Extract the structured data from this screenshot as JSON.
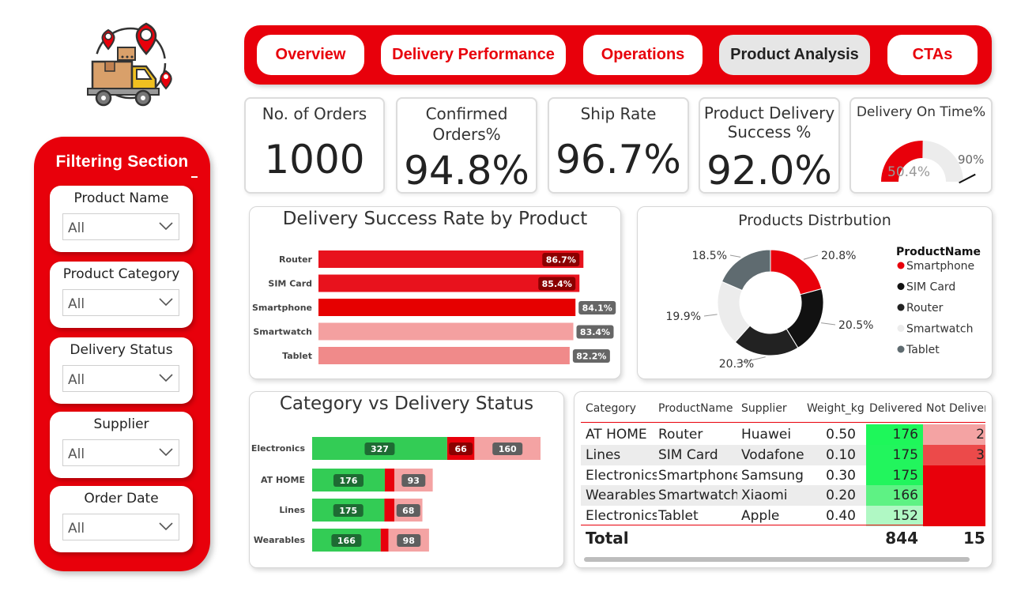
{
  "nav": {
    "tabs": [
      {
        "label": "Overview",
        "active": false
      },
      {
        "label": "Delivery Performance",
        "active": false
      },
      {
        "label": "Operations",
        "active": false
      },
      {
        "label": "Product Analysis",
        "active": true
      },
      {
        "label": "CTAs",
        "active": false
      }
    ]
  },
  "filters": {
    "title": "Filtering Section",
    "items": [
      {
        "label": "Product Name",
        "value": "All"
      },
      {
        "label": "Product Category",
        "value": "All"
      },
      {
        "label": "Delivery Status",
        "value": "All"
      },
      {
        "label": "Supplier",
        "value": "All"
      },
      {
        "label": "Order Date",
        "value": "All"
      }
    ]
  },
  "kpis": {
    "orders": {
      "title": "No. of Orders",
      "value": "1000"
    },
    "confirmed": {
      "title1": "Confirmed",
      "title2": "Orders%",
      "value": "94.8%"
    },
    "ship_rate": {
      "title": "Ship Rate",
      "value": "96.7%"
    },
    "success": {
      "title1": "Product Delivery",
      "title2": "Success %",
      "value": "92.0%"
    },
    "on_time": {
      "title": "Delivery On Time%",
      "value": "50.4%",
      "target": "90%"
    }
  },
  "colors": {
    "brand_red": "#e8000b",
    "dark_red": "#8b0000",
    "light_red": "#f4a3a3",
    "green": "#33cc55",
    "dark_green": "#1e6b33",
    "grey": "#5f6b70"
  },
  "chart_data": [
    {
      "type": "gauge",
      "title": "Delivery On Time%",
      "value": 50.4,
      "target": 90,
      "ylim": [
        0,
        100
      ]
    },
    {
      "type": "bar",
      "orientation": "horizontal",
      "title": "Delivery Success Rate by Product",
      "categories": [
        "Router",
        "SIM Card",
        "Smartphone",
        "Smartwatch",
        "Tablet"
      ],
      "values": [
        86.7,
        85.4,
        84.1,
        83.4,
        82.2
      ],
      "labels": [
        "86.7%",
        "85.4%",
        "84.1%",
        "83.4%",
        "82.2%"
      ],
      "colors": [
        "#e8121d",
        "#e8121d",
        "#e60000",
        "#f4a0a0",
        "#f08a8a"
      ],
      "label_bg": [
        "#8b0000",
        "#8b0000",
        "#666666",
        "#666666",
        "#666666"
      ],
      "xlim": [
        0,
        100
      ]
    },
    {
      "type": "pie",
      "donut": true,
      "title": "Products Distrbution",
      "legend_title": "ProductName",
      "legend_position": "right",
      "slices": [
        {
          "name": "Smartphone",
          "value": 20.8,
          "label": "20.8%",
          "color": "#e8000b"
        },
        {
          "name": "SIM Card",
          "value": 20.5,
          "label": "20.5%",
          "color": "#111111"
        },
        {
          "name": "Router",
          "value": 20.3,
          "label": "20.3%",
          "color": "#222222"
        },
        {
          "name": "Smartwatch",
          "value": 19.9,
          "label": "19.9%",
          "color": "#ececec"
        },
        {
          "name": "Tablet",
          "value": 18.5,
          "label": "18.5%",
          "color": "#5f6b70"
        }
      ]
    },
    {
      "type": "bar",
      "orientation": "horizontal",
      "stacked": true,
      "title": "Category vs Delivery Status",
      "categories": [
        "Electronics",
        "AT HOME",
        "Lines",
        "Wearables"
      ],
      "series": [
        {
          "values": [
            327,
            176,
            175,
            166
          ],
          "labels": [
            "327",
            "176",
            "175",
            "166"
          ],
          "color": "#33cc55"
        },
        {
          "values": [
            66,
            23,
            24,
            19
          ],
          "labels": [
            "66",
            "",
            "",
            ""
          ],
          "color": "#e8000b"
        },
        {
          "values": [
            160,
            93,
            68,
            98
          ],
          "labels": [
            "160",
            "93",
            "68",
            "98"
          ],
          "color": "#f4a3a3"
        }
      ]
    }
  ],
  "table": {
    "columns": [
      "Category",
      "ProductName",
      "Supplier",
      "Weight_kg",
      "Delivered",
      "Not Delivere"
    ],
    "rows": [
      {
        "category": "AT HOME",
        "product": "Router",
        "supplier": "Huawei",
        "weight": "0.50",
        "delivered": "176",
        "not_delivered": "2",
        "delivered_color": "#1ef75a",
        "nd_color": "#f4a3a3"
      },
      {
        "category": "Lines",
        "product": "SIM Card",
        "supplier": "Vodafone",
        "weight": "0.10",
        "delivered": "175",
        "not_delivered": "3",
        "delivered_color": "#22f55d",
        "nd_color": "#ec4a4a"
      },
      {
        "category": "Electronics",
        "product": "Smartphone",
        "supplier": "Samsung",
        "weight": "0.30",
        "delivered": "175",
        "not_delivered": "",
        "delivered_color": "#22f55d",
        "nd_color": "#e8000b"
      },
      {
        "category": "Wearables",
        "product": "Smartwatch",
        "supplier": "Xiaomi",
        "weight": "0.20",
        "delivered": "166",
        "not_delivered": "",
        "delivered_color": "#5ef284",
        "nd_color": "#e8000b"
      },
      {
        "category": "Electronics",
        "product": "Tablet",
        "supplier": "Apple",
        "weight": "0.40",
        "delivered": "152",
        "not_delivered": "",
        "delivered_color": "#b0f8c4",
        "nd_color": "#e8000b"
      }
    ],
    "total": {
      "label": "Total",
      "delivered": "844",
      "not_delivered": "15"
    }
  }
}
